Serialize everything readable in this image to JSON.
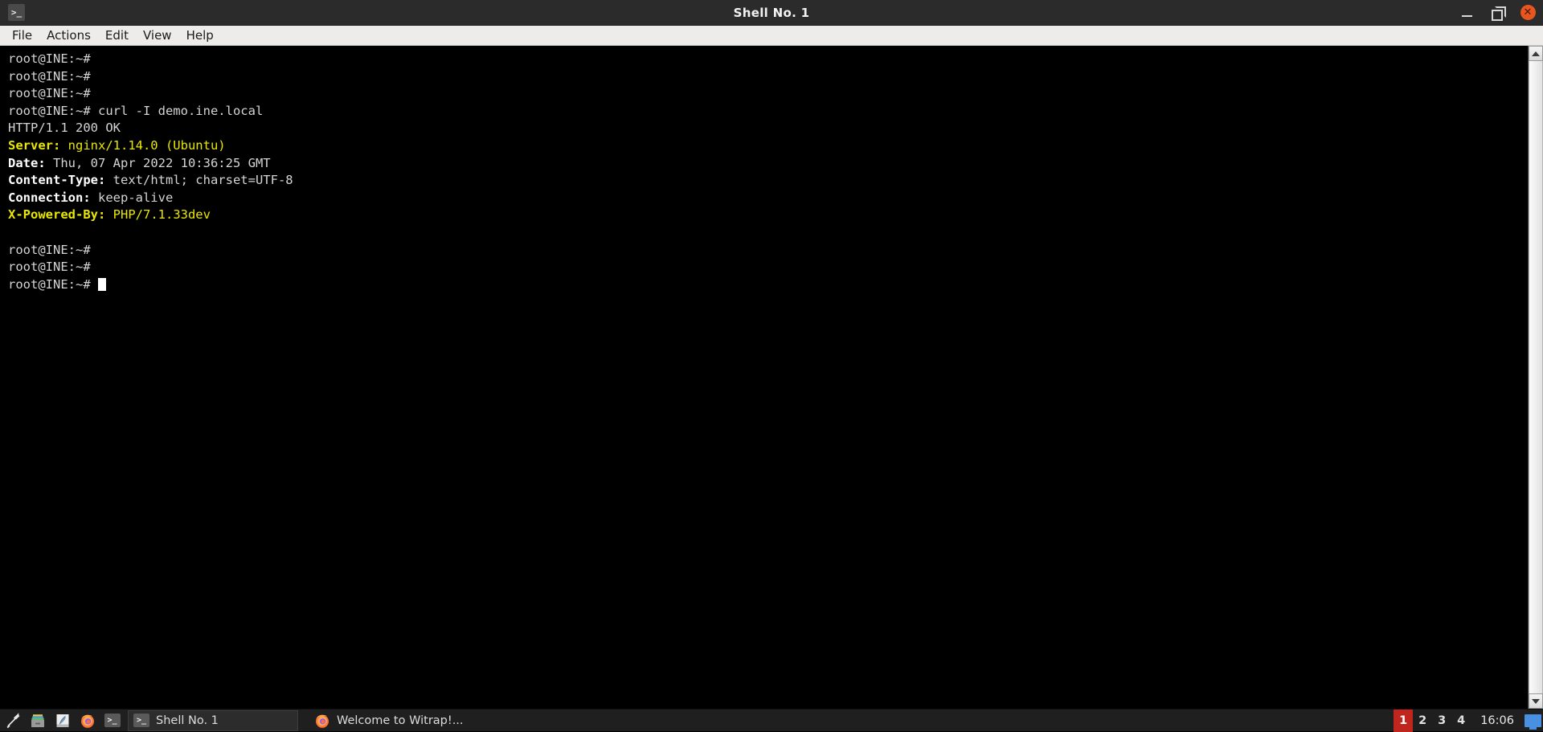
{
  "window": {
    "title": "Shell No. 1",
    "icon": "terminal-icon",
    "icon_glyph": ">_",
    "controls": {
      "minimize": "minimize-button",
      "maximize": "maximize-button",
      "close": "close-button",
      "close_glyph": "✕"
    }
  },
  "menubar": {
    "items": [
      {
        "label": "File"
      },
      {
        "label": "Actions"
      },
      {
        "label": "Edit"
      },
      {
        "label": "View"
      },
      {
        "label": "Help"
      }
    ]
  },
  "terminal": {
    "prompt": "root@INE:~# ",
    "lines": [
      {
        "type": "prompt"
      },
      {
        "type": "prompt"
      },
      {
        "type": "prompt"
      },
      {
        "type": "command",
        "command": "curl -I demo.ine.local"
      },
      {
        "type": "plain",
        "text": "HTTP/1.1 200 OK"
      },
      {
        "type": "header-yellow",
        "name": "Server:",
        "value": " nginx/1.14.0 (Ubuntu)"
      },
      {
        "type": "header-white",
        "name": "Date:",
        "value": " Thu, 07 Apr 2022 10:36:25 GMT"
      },
      {
        "type": "header-white",
        "name": "Content-Type:",
        "value": " text/html; charset=UTF-8"
      },
      {
        "type": "header-white",
        "name": "Connection:",
        "value": " keep-alive"
      },
      {
        "type": "header-yellow",
        "name": "X-Powered-By:",
        "value": " PHP/7.1.33dev"
      },
      {
        "type": "blank"
      },
      {
        "type": "prompt"
      },
      {
        "type": "prompt"
      },
      {
        "type": "cursor"
      }
    ],
    "colors": {
      "background": "#000000",
      "foreground": "#d4d4d4",
      "yellow": "#e8e800",
      "cursor": "#ffffff"
    }
  },
  "scrollbar": {
    "up_arrow": "scroll-up-arrow",
    "down_arrow": "scroll-down-arrow"
  },
  "taskbar": {
    "launchers": [
      {
        "name": "tools-icon",
        "title": "Tools"
      },
      {
        "name": "file-manager-icon",
        "title": "File Manager"
      },
      {
        "name": "text-editor-icon",
        "title": "Text Editor"
      },
      {
        "name": "firefox-icon",
        "title": "Firefox"
      },
      {
        "name": "terminal-icon",
        "title": "Terminal",
        "glyph": ">_"
      }
    ],
    "tasks": [
      {
        "label": "Shell No. 1",
        "icon": "terminal-icon",
        "glyph": ">_",
        "active": true
      },
      {
        "label": "Welcome to Witrap!...",
        "icon": "firefox-icon",
        "active": false
      }
    ],
    "workspaces": [
      {
        "label": "1",
        "active": true
      },
      {
        "label": "2",
        "active": false
      },
      {
        "label": "3",
        "active": false
      },
      {
        "label": "4",
        "active": false
      }
    ],
    "clock": "16:06",
    "tray": [
      {
        "name": "display-icon",
        "color": "#4a90e2"
      }
    ],
    "colors": {
      "background": "#1f1f1f",
      "active_workspace": "#c0261d"
    }
  }
}
